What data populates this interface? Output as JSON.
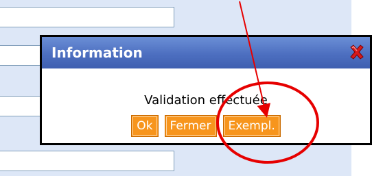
{
  "dialog": {
    "title": "Information",
    "message": "Validation effectuée",
    "buttons": {
      "ok": "Ok",
      "close": "Fermer",
      "example": "Exempl."
    },
    "close_icon": "close-x-icon"
  },
  "colors": {
    "titlebar": "#4d6fc0",
    "button": "#f7951d",
    "annotation": "#e60000",
    "background_form": "#dde7f7"
  }
}
